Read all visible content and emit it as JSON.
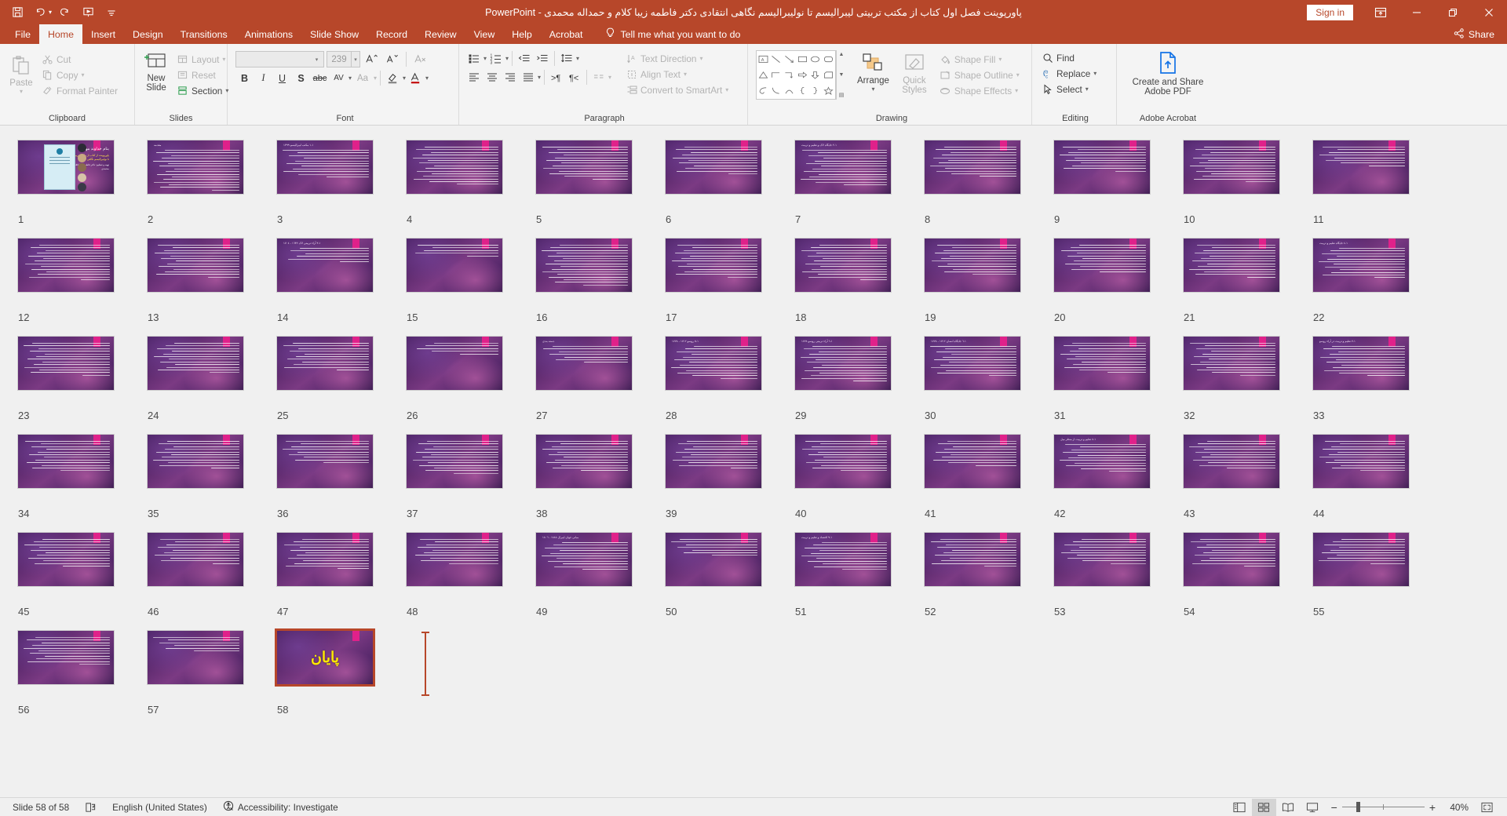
{
  "titlebar": {
    "document_title": "پاورپوینت فصل اول کتاب از مکتب تربیتی لیبرالیسم تا نولیبرالیسم نگاهی انتقادی دکتر فاطمه زیبا کلام و حمداله محمدی  -  PowerPoint",
    "sign_in": "Sign in",
    "qat": [
      {
        "name": "save-icon",
        "label": "Save"
      },
      {
        "name": "undo-icon",
        "label": "Undo"
      },
      {
        "name": "redo-icon",
        "label": "Redo"
      },
      {
        "name": "start-presentation-icon",
        "label": "Start From Beginning"
      },
      {
        "name": "customize-qat-icon",
        "label": "Customize Quick Access Toolbar"
      }
    ],
    "window_controls": {
      "ribbon_display": "Ribbon Display Options",
      "minimize": "Minimize",
      "restore": "Restore Down",
      "close": "Close"
    }
  },
  "tabs": [
    {
      "label": "File",
      "active": false
    },
    {
      "label": "Home",
      "active": true
    },
    {
      "label": "Insert",
      "active": false
    },
    {
      "label": "Design",
      "active": false
    },
    {
      "label": "Transitions",
      "active": false
    },
    {
      "label": "Animations",
      "active": false
    },
    {
      "label": "Slide Show",
      "active": false
    },
    {
      "label": "Record",
      "active": false
    },
    {
      "label": "Review",
      "active": false
    },
    {
      "label": "View",
      "active": false
    },
    {
      "label": "Help",
      "active": false
    },
    {
      "label": "Acrobat",
      "active": false
    }
  ],
  "tell_me": "Tell me what you want to do",
  "share": "Share",
  "ribbon": {
    "clipboard": {
      "label": "Clipboard",
      "paste": "Paste",
      "cut": "Cut",
      "copy": "Copy",
      "format_painter": "Format Painter"
    },
    "slides": {
      "label": "Slides",
      "new_slide": "New\nSlide",
      "new_slide_line1": "New",
      "new_slide_line2": "Slide",
      "layout": "Layout",
      "reset": "Reset",
      "section": "Section"
    },
    "font": {
      "label": "Font",
      "font_name": "",
      "font_size": "239",
      "bold": "B",
      "italic": "I",
      "underline": "U",
      "shadow": "S",
      "strikethrough": "abc",
      "character_spacing": "AV",
      "change_case": "Aa",
      "increase_font": "A",
      "decrease_font": "A",
      "clear_formatting": "A"
    },
    "paragraph": {
      "label": "Paragraph",
      "text_direction": "Text Direction",
      "align_text": "Align Text",
      "convert_to_smartart": "Convert to SmartArt"
    },
    "drawing": {
      "label": "Drawing",
      "arrange": "Arrange",
      "quick_styles_line1": "Quick",
      "quick_styles_line2": "Styles",
      "shape_fill": "Shape Fill",
      "shape_outline": "Shape Outline",
      "shape_effects": "Shape Effects"
    },
    "editing": {
      "label": "Editing",
      "find": "Find",
      "replace": "Replace",
      "select": "Select"
    },
    "acrobat": {
      "label": "Adobe Acrobat",
      "create_pdf_line1": "Create and Share",
      "create_pdf_line2": "Adobe PDF"
    }
  },
  "slides": [
    {
      "n": "1",
      "kind": "cover"
    },
    {
      "n": "2",
      "kind": "text",
      "header": "مقدمه",
      "lines": 16
    },
    {
      "n": "3",
      "kind": "text",
      "header": "١-١ مکتب لیبرالیسم ١٣٩٩",
      "lines": 11
    },
    {
      "n": "4",
      "kind": "text",
      "header": "",
      "lines": 15
    },
    {
      "n": "5",
      "kind": "text",
      "header": "",
      "lines": 13
    },
    {
      "n": "6",
      "kind": "text",
      "header": "",
      "lines": 11
    },
    {
      "n": "7",
      "kind": "text",
      "header": "١-٢ جایگاه لاک و تعلیم و تربیت",
      "lines": 14
    },
    {
      "n": "8",
      "kind": "text",
      "header": "",
      "lines": 12
    },
    {
      "n": "9",
      "kind": "text",
      "header": "",
      "lines": 10
    },
    {
      "n": "10",
      "kind": "text",
      "header": "",
      "lines": 14
    },
    {
      "n": "11",
      "kind": "text",
      "header": "",
      "lines": 8
    },
    {
      "n": "12",
      "kind": "text",
      "header": "",
      "lines": 14
    },
    {
      "n": "13",
      "kind": "text",
      "header": "",
      "lines": 13
    },
    {
      "n": "14",
      "kind": "text",
      "header": "١-٣ آراء تربیتی لاک ١٦٣٢ - ١٧٠٤",
      "lines": 6
    },
    {
      "n": "15",
      "kind": "text",
      "header": "",
      "lines": 5
    },
    {
      "n": "16",
      "kind": "text",
      "header": "",
      "lines": 16
    },
    {
      "n": "17",
      "kind": "text",
      "header": "",
      "lines": 13
    },
    {
      "n": "18",
      "kind": "text",
      "header": "",
      "lines": 14
    },
    {
      "n": "19",
      "kind": "text",
      "header": "",
      "lines": 12
    },
    {
      "n": "20",
      "kind": "text",
      "header": "",
      "lines": 11
    },
    {
      "n": "21",
      "kind": "text",
      "header": "",
      "lines": 13
    },
    {
      "n": "22",
      "kind": "text",
      "header": "١-٤ جایگاه تعلیم و تربیت",
      "lines": 12
    },
    {
      "n": "23",
      "kind": "text",
      "header": "",
      "lines": 13
    },
    {
      "n": "24",
      "kind": "text",
      "header": "",
      "lines": 12
    },
    {
      "n": "25",
      "kind": "text",
      "header": "",
      "lines": 11
    },
    {
      "n": "26",
      "kind": "text",
      "header": "",
      "lines": 5
    },
    {
      "n": "27",
      "kind": "text",
      "header": "دسته بندی",
      "lines": 7
    },
    {
      "n": "28",
      "kind": "text",
      "header": "١-٥ روسو ١٧١٢ - ١٧٧٨",
      "lines": 13
    },
    {
      "n": "29",
      "kind": "text",
      "header": "١-٦ آراء تربیتی روسو ١٧٧٨",
      "lines": 14
    },
    {
      "n": "30",
      "kind": "text",
      "header": "١-٦ جایگاه انسان ١٧١٢ - ١٧٧٨",
      "lines": 12
    },
    {
      "n": "31",
      "kind": "text",
      "header": "",
      "lines": 12
    },
    {
      "n": "32",
      "kind": "text",
      "header": "",
      "lines": 13
    },
    {
      "n": "33",
      "kind": "text",
      "header": "١-٧ تعلیم و تربیت در آراء روسو",
      "lines": 12
    },
    {
      "n": "34",
      "kind": "text",
      "header": "",
      "lines": 12
    },
    {
      "n": "35",
      "kind": "text",
      "header": "",
      "lines": 11
    },
    {
      "n": "36",
      "kind": "text",
      "header": "",
      "lines": 9
    },
    {
      "n": "37",
      "kind": "text",
      "header": "",
      "lines": 13
    },
    {
      "n": "38",
      "kind": "text",
      "header": "",
      "lines": 12
    },
    {
      "n": "39",
      "kind": "text",
      "header": "",
      "lines": 11
    },
    {
      "n": "40",
      "kind": "text",
      "header": "",
      "lines": 12
    },
    {
      "n": "41",
      "kind": "text",
      "header": "",
      "lines": 10
    },
    {
      "n": "42",
      "kind": "text",
      "header": "١-٨ تعلیم و تربیت از منظر میل",
      "lines": 11
    },
    {
      "n": "43",
      "kind": "text",
      "header": "",
      "lines": 11
    },
    {
      "n": "44",
      "kind": "text",
      "header": "",
      "lines": 12
    },
    {
      "n": "45",
      "kind": "text",
      "header": "",
      "lines": 11
    },
    {
      "n": "46",
      "kind": "text",
      "header": "",
      "lines": 10
    },
    {
      "n": "47",
      "kind": "text",
      "header": "",
      "lines": 12
    },
    {
      "n": "48",
      "kind": "text",
      "header": "",
      "lines": 10
    },
    {
      "n": "49",
      "kind": "text",
      "header": "مبانی جهان لیبرال ١٨٨٨ - ١٨٠٦",
      "lines": 11
    },
    {
      "n": "50",
      "kind": "text",
      "header": "",
      "lines": 7
    },
    {
      "n": "51",
      "kind": "text",
      "header": "١-٩ اقتصاد و تعلیم و تربیت",
      "lines": 11
    },
    {
      "n": "52",
      "kind": "text",
      "header": "",
      "lines": 11
    },
    {
      "n": "53",
      "kind": "text",
      "header": "",
      "lines": 10
    },
    {
      "n": "54",
      "kind": "text",
      "header": "",
      "lines": 11
    },
    {
      "n": "55",
      "kind": "text",
      "header": "",
      "lines": 10
    },
    {
      "n": "56",
      "kind": "text",
      "header": "",
      "lines": 11
    },
    {
      "n": "57",
      "kind": "text",
      "header": "",
      "lines": 6
    },
    {
      "n": "58",
      "kind": "end",
      "end_text": "پایان"
    }
  ],
  "slide1": {
    "title": "بنام خداوند مهربان",
    "yellow_text": "پاورپوینت از کتاب از مکتب تربیتی لیبرالیسم تا نولیبرالیسم نگاهی انتقادی",
    "white_text": "تهیه و تنظیم: دکتر فاطمه زیبا کلام و حمداله محمدی"
  },
  "statusbar": {
    "slide_count": "Slide 58 of 58",
    "notes_icon": "notes-icon",
    "language": "English (United States)",
    "accessibility": "Accessibility: Investigate",
    "views": [
      {
        "name": "normal-view",
        "active": false
      },
      {
        "name": "slide-sorter-view",
        "active": true
      },
      {
        "name": "reading-view",
        "active": false
      },
      {
        "name": "slide-show-view",
        "active": false
      }
    ],
    "zoom_out": "−",
    "zoom_in": "+",
    "zoom_level": "40%",
    "fit_to_window": "fit-slide-icon"
  },
  "colors": {
    "accent": "#b7472a",
    "ribbon_bg": "#f4f4f4",
    "sorter_bg": "#f0f0f0",
    "tag": "#e0218a"
  }
}
